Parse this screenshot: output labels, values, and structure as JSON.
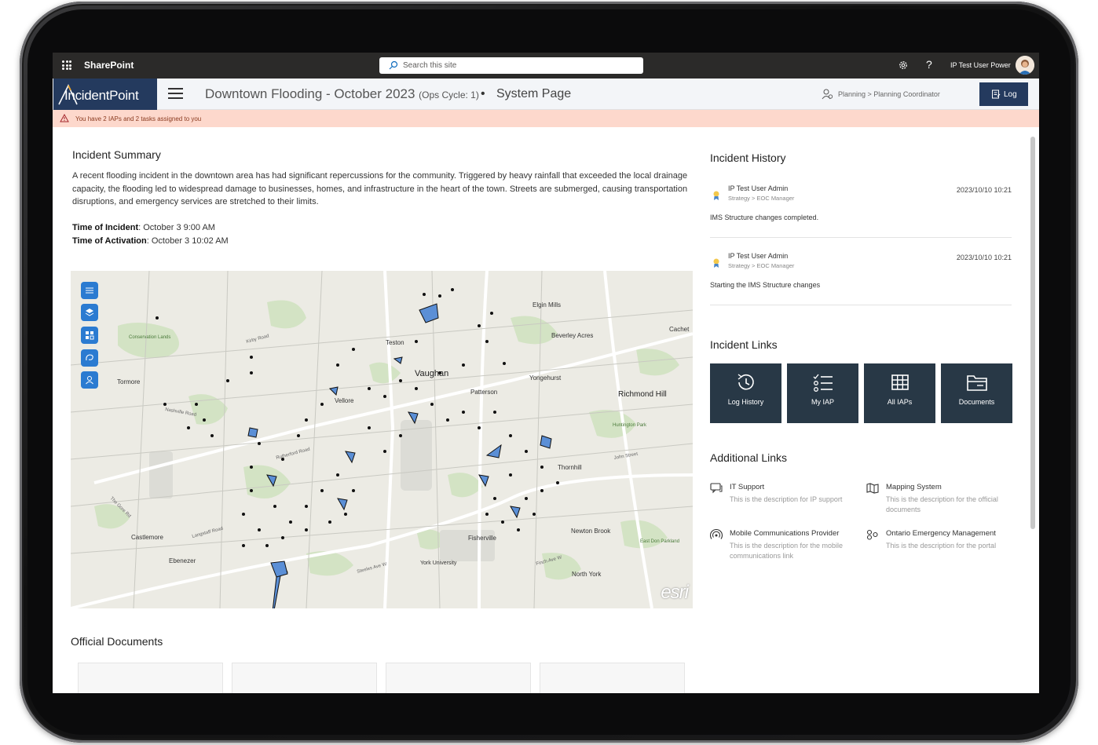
{
  "suitebar": {
    "app_name": "SharePoint",
    "search_placeholder": "Search this site",
    "help_label": "?",
    "user_name": "IP Test User Power"
  },
  "header": {
    "logo_text": "IncidentPoint",
    "incident_title": "Downtown Flooding - October 2023",
    "ops_cycle": "(Ops Cycle: 1)",
    "separator": "•",
    "page_name": "System Page",
    "role_path": "Planning > Planning Coordinator",
    "log_button": "Log"
  },
  "notice": {
    "text": "You have 2 IAPs and 2 tasks assigned to you"
  },
  "summary": {
    "heading": "Incident Summary",
    "body": "A recent flooding incident in the downtown area has had significant repercussions for the community. Triggered by heavy rainfall that exceeded the local drainage capacity, the flooding led to widespread damage to businesses, homes, and infrastructure in the heart of the town. Streets are submerged, causing transportation disruptions, and emergency services are stretched to their limits.",
    "time_incident_label": "Time of Incident",
    "time_incident_value": ": October 3 9:00 AM",
    "time_activation_label": "Time of Activation",
    "time_activation_value": ": October 3 10:02 AM"
  },
  "map": {
    "attribution": "esri",
    "labels": {
      "elgin_mills": "Elgin Mills",
      "cachet": "Cachet",
      "beverley_acres": "Beverley Acres",
      "teston": "Teston",
      "vaughan": "Vaughan",
      "yongehurst": "Yongehurst",
      "richmond_hill": "Richmond Hill",
      "patterson": "Patterson",
      "tormore": "Tormore",
      "vellore": "Vellore",
      "conservation_lands": "Conservation Lands",
      "huntington_park": "Huntington Park",
      "thornhill": "Thornhill",
      "castlemore": "Castlemore",
      "ebenezer": "Ebenezer",
      "fisherville": "Fisherville",
      "newton_brook": "Newton Brook",
      "york_university": "York University",
      "north_york": "North York",
      "east_don_parkland": "East Don Parkland",
      "kirby_road": "Kirby Road",
      "rutherford_road": "Rutherford Road",
      "langstaff_road": "Langstaff Road",
      "steeles_ave_w": "Steeles Ave W",
      "finch_ave_w": "Finch Ave W",
      "john_street": "John Street",
      "nashville_road": "Nashville Road",
      "the_gore_rd": "The Gore Rd"
    }
  },
  "official_documents": {
    "heading": "Official Documents"
  },
  "history": {
    "heading": "Incident History",
    "items": [
      {
        "user": "IP Test User Admin",
        "role": "Strategy > EOC Manager",
        "time": "2023/10/10 10:21",
        "message": "IMS Structure changes completed."
      },
      {
        "user": "IP Test User Admin",
        "role": "Strategy > EOC Manager",
        "time": "2023/10/10 10:21",
        "message": "Starting the IMS Structure changes"
      }
    ]
  },
  "incident_links": {
    "heading": "Incident Links",
    "tiles": [
      {
        "label": "Log History",
        "icon": "history-icon"
      },
      {
        "label": "My IAP",
        "icon": "checklist-icon"
      },
      {
        "label": "All IAPs",
        "icon": "grid-icon"
      },
      {
        "label": "Documents",
        "icon": "folder-icon"
      }
    ]
  },
  "additional_links": {
    "heading": "Additional Links",
    "items": [
      {
        "title": "IT Support",
        "desc": "This is the description for IP support",
        "icon": "chat-icon"
      },
      {
        "title": "Mapping System",
        "desc": "This is the description for the official documents",
        "icon": "map-icon"
      },
      {
        "title": "Mobile Communications Provider",
        "desc": "This is the description for the mobile communications link",
        "icon": "broadcast-icon"
      },
      {
        "title": "Ontario Emergency Management",
        "desc": "This is the description for the portal",
        "icon": "org-icon"
      }
    ]
  },
  "colors": {
    "suitebar": "#2b2a29",
    "brand_navy": "#243a5e",
    "tile_bg": "#283846",
    "notice_bg": "#fdd8cc",
    "map_polygon": "#5b8fd6"
  }
}
